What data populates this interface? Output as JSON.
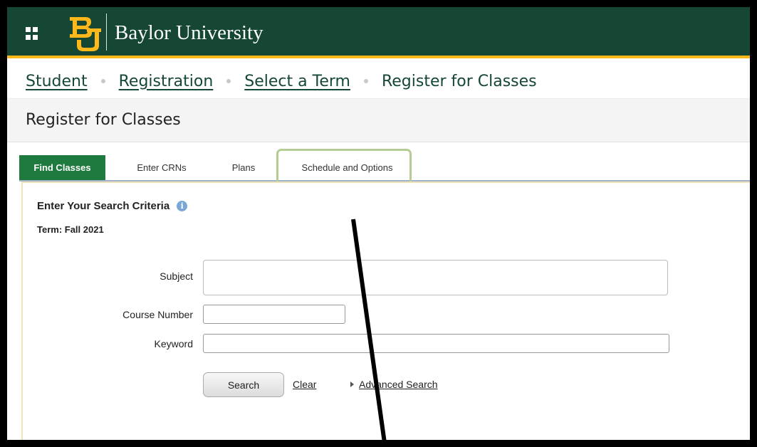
{
  "colors": {
    "brand": "#154734",
    "gold": "#ffb81c",
    "active_tab": "#1e7a3f",
    "highlight": "#b5cc95"
  },
  "header": {
    "menu_icon": "grid-menu-icon",
    "logo_icon": "baylor-bu-logo",
    "university_name": "Baylor University"
  },
  "breadcrumb": {
    "items": [
      {
        "label": "Student"
      },
      {
        "label": "Registration"
      },
      {
        "label": "Select a Term"
      }
    ],
    "current": "Register for Classes"
  },
  "page": {
    "title": "Register for Classes"
  },
  "tabs": [
    {
      "label": "Find Classes",
      "active": true
    },
    {
      "label": "Enter CRNs",
      "active": false
    },
    {
      "label": "Plans",
      "active": false
    },
    {
      "label": "Schedule and Options",
      "active": false
    }
  ],
  "search": {
    "heading": "Enter Your Search Criteria",
    "info_icon": "info-icon",
    "term": "Term: Fall 2021",
    "subject_label": "Subject",
    "subject_value": "",
    "course_number_label": "Course Number",
    "course_number_value": "",
    "keyword_label": "Keyword",
    "keyword_value": "",
    "search_button": "Search",
    "clear_link": "Clear",
    "advanced_link": "Advanced Search"
  }
}
